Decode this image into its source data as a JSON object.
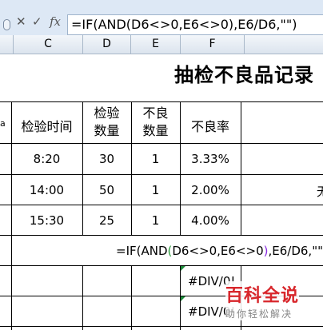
{
  "formula_bar": {
    "cancel_glyph": "✕",
    "enter_glyph": "✓",
    "fx_glyph": "fx",
    "formula": "=IF(AND(D6<>0,E6<>0),E6/D6,\"\")"
  },
  "column_headers": [
    "C",
    "D",
    "E",
    "F"
  ],
  "sheet": {
    "title": "抽检不良品记录",
    "edge_fragment": "a",
    "header": {
      "time": "检验时间",
      "qty_line1": "检验",
      "qty_line2": "数量",
      "defect_line1": "不良",
      "defect_line2": "数量",
      "rate": "不良率"
    },
    "rows": [
      {
        "time": "8:20",
        "qty": "30",
        "defects": "1",
        "rate": "3.33%"
      },
      {
        "time": "14:00",
        "qty": "50",
        "defects": "1",
        "rate": "2.00%"
      },
      {
        "time": "15:30",
        "qty": "25",
        "defects": "1",
        "rate": "4.00%"
      }
    ],
    "right_fragment": "无",
    "formula_display": {
      "part1": "=IF(AND",
      "paren_open": "(",
      "part2": "D6<>0,E6<>0",
      "paren_close": ")",
      "part3": ",E6/D6,\"\")"
    },
    "div_errors": [
      "#DIV/0!",
      "#DIV/0!"
    ]
  },
  "watermark": {
    "main": "百科全说",
    "sub": "助你轻松解决"
  },
  "colors": {
    "formula_paren_green": "#2e9c3e",
    "formula_paren_purple": "#8a2be2",
    "watermark_red": "#d8262b"
  }
}
